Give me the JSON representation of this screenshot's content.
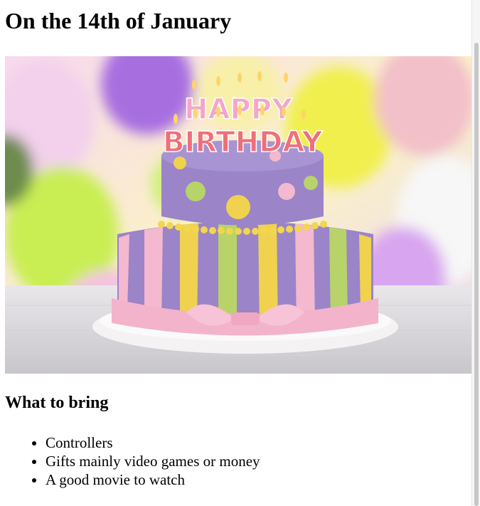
{
  "page": {
    "title": "On the 14th of January",
    "image": {
      "topper_top": "HAPPY",
      "topper_bottom": "BIRTHDAY"
    },
    "section_heading": "What to bring",
    "items": [
      {
        "label": "Controllers"
      },
      {
        "label": "Gifts mainly video games or money"
      },
      {
        "label": "A good movie to watch"
      }
    ]
  },
  "colors": {
    "cake_purple": "#9b84c8",
    "cake_pink": "#f4b8cf",
    "cake_green": "#b7d36a",
    "cake_yellow": "#f0d24f"
  }
}
